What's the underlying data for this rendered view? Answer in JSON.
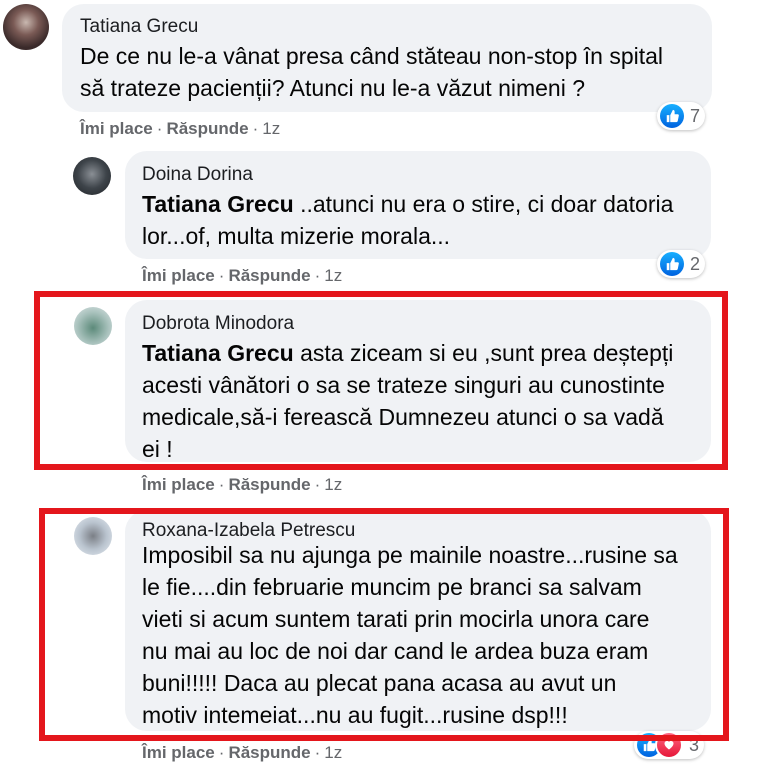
{
  "comments": [
    {
      "author": "Tatiana Grecu",
      "line1": "De ce nu le-a vânat presa când stăteau non-stop în spital",
      "line2": "să trateze pacienții? Atunci nu le-a văzut nimeni ?",
      "like": "Îmi place",
      "reply": "Răspunde",
      "time": "1z",
      "reactions": "7"
    },
    {
      "author": "Doina Dorina",
      "mention": "Tatiana Grecu",
      "line1": " ..atunci nu era o stire, ci doar datoria",
      "line2": "lor...of, multa mizerie morala...",
      "like": "Îmi place",
      "reply": "Răspunde",
      "time": "1z",
      "reactions": "2"
    },
    {
      "author": "Dobrota Minodora",
      "mention": "Tatiana Grecu",
      "line1": " asta ziceam si eu ,sunt prea deștepți",
      "line2": "acesti vânători o sa se trateze singuri au cunostinte",
      "line3": "medicale,să-i ferească Dumnezeu atunci o sa vadă",
      "line4": "ei !",
      "like": "Îmi place",
      "reply": "Răspunde",
      "time": "1z"
    },
    {
      "author": "Roxana-Izabela Petrescu",
      "line1": "Imposibil sa nu ajunga pe mainile noastre...rusine sa",
      "line2": "le fie....din februarie muncim pe branci sa salvam",
      "line3": "vieti si acum suntem tarati prin mocirla unora care",
      "line4": "nu mai au loc de noi dar cand le ardea buza eram",
      "line5": "buni!!!!! Daca au plecat pana acasa au avut un",
      "line6": "motiv intemeiat...nu au fugit...rusine dsp!!!",
      "like": "Îmi place",
      "reply": "Răspunde",
      "time": "1z",
      "reactions": "3"
    }
  ],
  "separator": "·",
  "colors": {
    "highlight": "#e4161c",
    "bubble": "#f0f2f5",
    "like": "#0571ed"
  }
}
